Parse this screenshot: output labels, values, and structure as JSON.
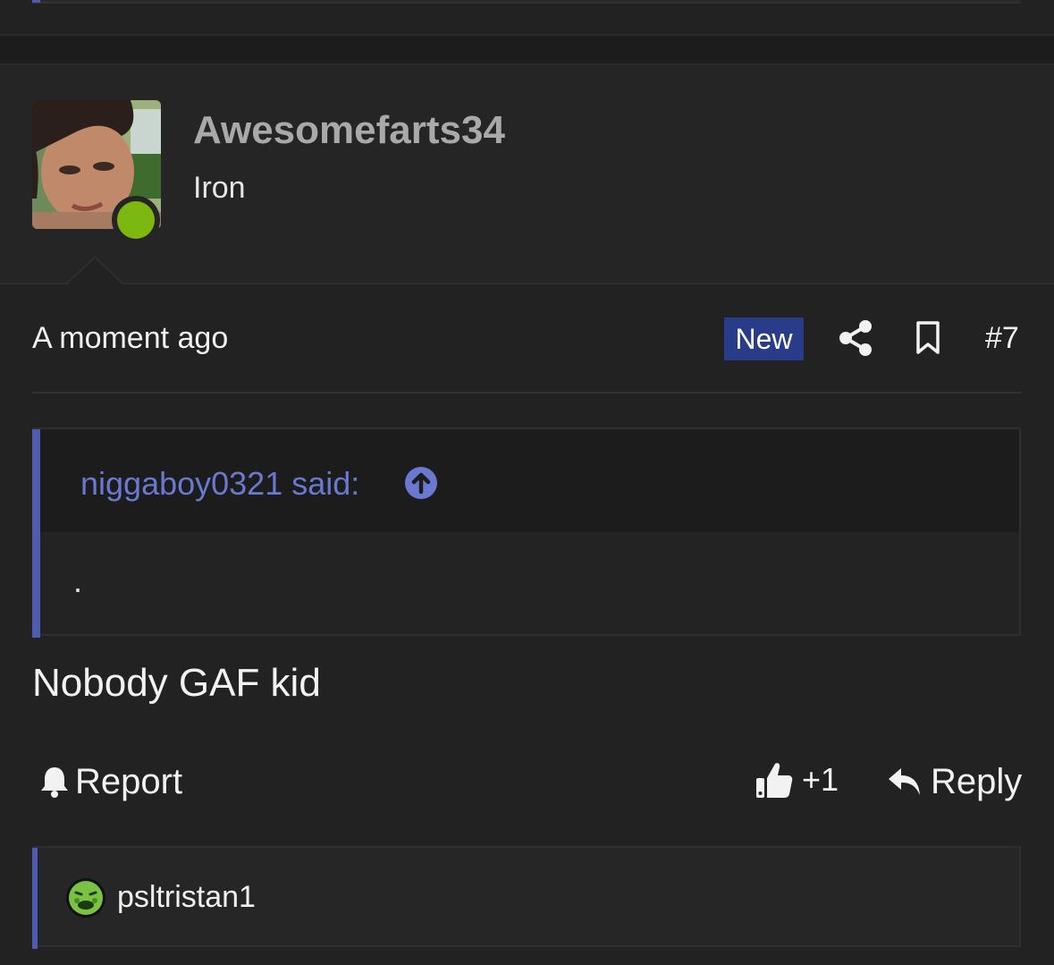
{
  "post": {
    "username": "Awesomefarts34",
    "user_title": "Iron",
    "time": "A moment ago",
    "badge": "New",
    "number": "#7",
    "quote": {
      "author_line": "niggaboy0321 said:",
      "text": "."
    },
    "message": "Nobody GAF kid",
    "actions": {
      "report": "Report",
      "reaction_count": "+1",
      "reply": "Reply"
    },
    "reactions": {
      "user": "psltristan1"
    }
  },
  "colors": {
    "background": "#222222",
    "quote_accent": "#4f5bb0",
    "quote_author": "#6a79cf",
    "new_badge": "#283c8a",
    "online": "#7cb80f",
    "username": "#a9a9a9"
  },
  "icons": [
    "share-icon",
    "bookmark-icon",
    "arrow-up-circle-icon",
    "bell-icon",
    "thumbs-up-icon",
    "reply-icon",
    "nauseated-face-icon"
  ]
}
